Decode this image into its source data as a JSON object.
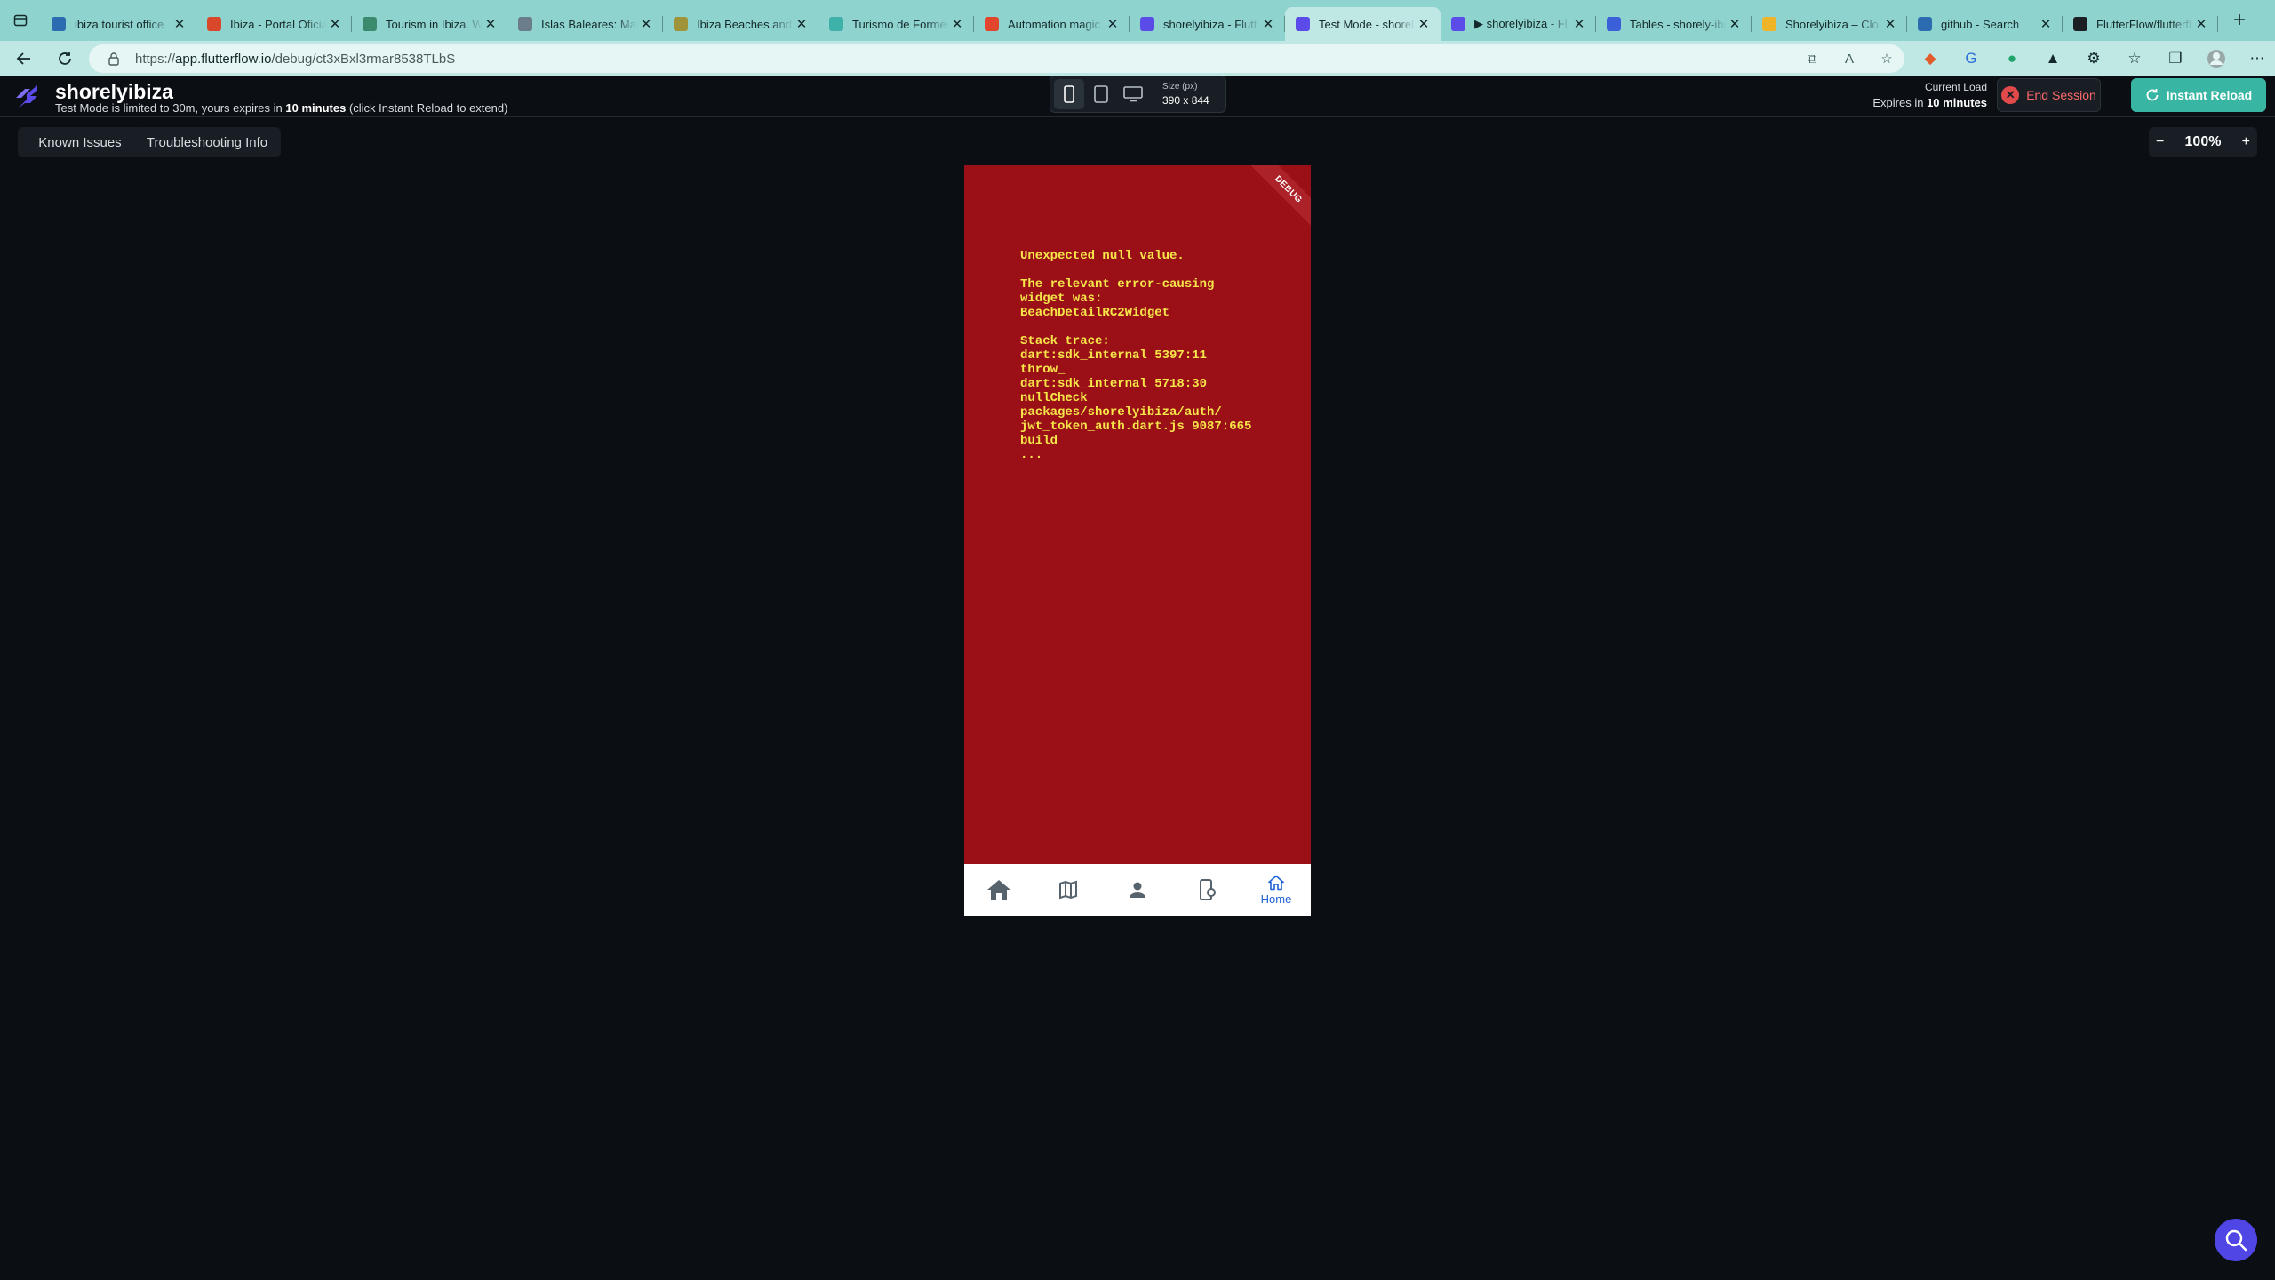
{
  "browser": {
    "tabs": [
      {
        "title": "ibiza tourist office",
        "favicon": "search-icon",
        "color": "#2b6cb0",
        "active": false
      },
      {
        "title": "Ibiza - Portal Oficial",
        "favicon": "flag-icon",
        "color": "#d9482b",
        "active": false
      },
      {
        "title": "Tourism in Ibiza. W",
        "favicon": "globe-icon",
        "color": "#3c8a6e",
        "active": false
      },
      {
        "title": "Islas Baleares: Mall",
        "favicon": "image-icon",
        "color": "#6b7c8a",
        "active": false
      },
      {
        "title": "Ibiza Beaches and",
        "favicon": "leaf-icon",
        "color": "#a0943a",
        "active": false
      },
      {
        "title": "Turismo de Formentera",
        "favicon": "circle-icon",
        "color": "#3eb2a8",
        "active": false
      },
      {
        "title": "Automation magic",
        "favicon": "zapier-icon",
        "color": "#e2452d",
        "active": false
      },
      {
        "title": "shorelyibiza - Flutt",
        "favicon": "flutterflow-icon",
        "color": "#5b4be8",
        "active": false
      },
      {
        "title": "Test Mode - shorel",
        "favicon": "flutterflow-icon",
        "color": "#5b4be8",
        "active": true
      },
      {
        "title": "▶ shorelyibiza - Fl",
        "favicon": "flutterflow-icon",
        "color": "#5b4be8",
        "active": false
      },
      {
        "title": "Tables - shorely-ibi",
        "favicon": "table-icon",
        "color": "#3b5fd8",
        "active": false
      },
      {
        "title": "Shorelyibiza – Clo",
        "favicon": "hand-icon",
        "color": "#f0b429",
        "active": false
      },
      {
        "title": "github - Search",
        "favicon": "search-icon",
        "color": "#2b6cb0",
        "active": false
      },
      {
        "title": "FlutterFlow/flutterfl",
        "favicon": "github-icon",
        "color": "#1b1f23",
        "active": false
      }
    ],
    "url_prefix": "https://",
    "url_host": "app.flutterflow.io",
    "url_path": "/debug/ct3xBxl3rmar8538TLbS",
    "close_glyph": "✕",
    "new_tab_glyph": "+"
  },
  "header": {
    "app_name": "shorelyibiza",
    "notice_prefix": "Test Mode is limited to 30m, yours expires in",
    "notice_bold": "10 minutes",
    "notice_suffix": "(click Instant Reload to extend)",
    "size_label": "Size (px)",
    "size_value": "390 x 844",
    "current_load_label": "Current Load",
    "expires_prefix": "Expires in",
    "expires_bold": "10 minutes",
    "end_session_label": "End Session",
    "instant_reload_label": "Instant Reload"
  },
  "toolbar": {
    "known_issues_label": "Known Issues",
    "troubleshooting_label": "Troubleshooting Info",
    "zoom_minus": "−",
    "zoom_value": "100%",
    "zoom_plus": "+"
  },
  "preview": {
    "debug_banner": "DEBUG",
    "error_text": "Unexpected null value.\n\nThe relevant error-causing\nwidget was:\nBeachDetailRC2Widget\n\nStack trace:\ndart:sdk_internal 5397:11\nthrow_\ndart:sdk_internal 5718:30\nnullCheck\npackages/shorelyibiza/auth/\njwt_token_auth.dart.js 9087:665\nbuild\n...",
    "nav_active_label": "Home",
    "colors": {
      "error_bg": "#9a1016",
      "error_text": "#f7e64a",
      "nav_active": "#1f63d6"
    }
  }
}
